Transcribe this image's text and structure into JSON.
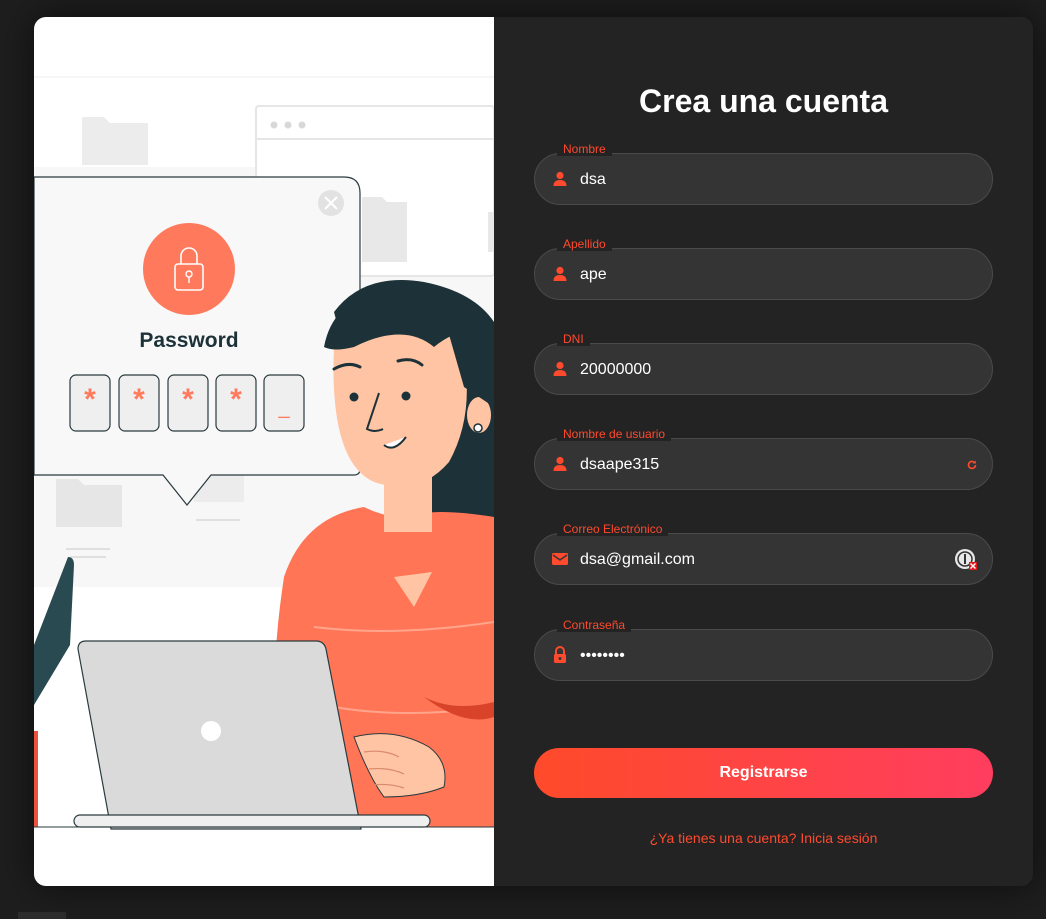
{
  "illustration": {
    "password_title": "Password",
    "password_mask": [
      "*",
      "*",
      "*",
      "*",
      "_"
    ],
    "accent_color": "#ff7a5c"
  },
  "form": {
    "title": "Crea una cuenta",
    "fields": [
      {
        "label": "Nombre",
        "value": "dsa",
        "icon": "user-icon"
      },
      {
        "label": "Apellido",
        "value": "ape",
        "icon": "user-icon"
      },
      {
        "label": "DNI",
        "value": "20000000",
        "icon": "user-icon"
      },
      {
        "label": "Nombre de usuario",
        "value": "dsaape315",
        "icon": "user-icon",
        "trailing_icon": "refresh-icon"
      },
      {
        "label": "Correo Electrónico",
        "value": "dsa@gmail.com",
        "icon": "mail-icon",
        "trailing_icon": "password-manager-icon"
      },
      {
        "label": "Contraseña",
        "value": "••••••••",
        "icon": "lock-icon"
      }
    ],
    "submit_label": "Registrarse",
    "login_link": "¿Ya tienes una cuenta? Inicia sesión"
  },
  "colors": {
    "accent": "#ff4a2e",
    "panel_bg": "#232323",
    "field_bg": "#343434",
    "button_gradient_start": "#ff4a2a",
    "button_gradient_end": "#ff3e5f"
  }
}
